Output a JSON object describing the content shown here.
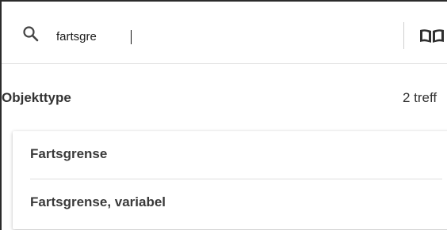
{
  "search": {
    "value": "fartsgre"
  },
  "icons": {
    "search": "search-icon",
    "book": "book-icon"
  },
  "section": {
    "title": "Objekttype",
    "count": "2 treff"
  },
  "results": [
    {
      "label": "Fartsgrense"
    },
    {
      "label": "Fartsgrense, variabel"
    }
  ]
}
